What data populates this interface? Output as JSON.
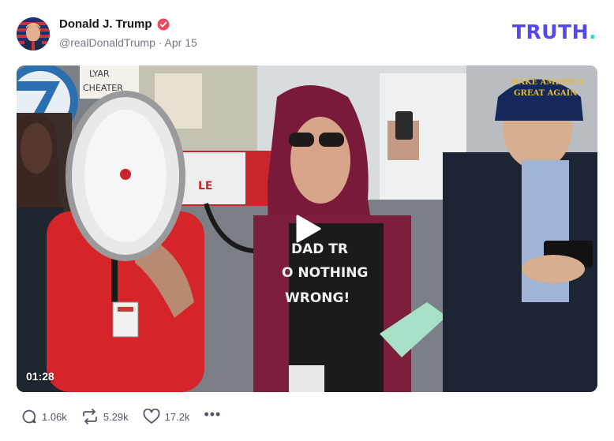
{
  "post": {
    "author_name": "Donald J. Trump",
    "handle": "@realDonaldTrump",
    "separator": " · ",
    "date": "Apr 15"
  },
  "brand": {
    "logo_text": "TRUTH",
    "logo_dot": ".",
    "colors": {
      "logo": "#5448ee",
      "dot": "#17e2c7",
      "verified": "#e94b5e"
    }
  },
  "video": {
    "duration": "01:28",
    "play_icon": "play-icon"
  },
  "video_texts": {
    "sign_liar": "LYAR",
    "sign_cheater": "CHEATER",
    "hat_line1": "MAKE AMERICA",
    "hat_line2": "GREAT AGAIN",
    "shirt_line1": "DAD TR",
    "shirt_line2": "O NOTHING",
    "shirt_line3": "WRONG!",
    "megaphone_text": "LE"
  },
  "actions": {
    "replies": "1.06k",
    "retruths": "5.29k",
    "likes": "17.2k",
    "more": "•••"
  }
}
